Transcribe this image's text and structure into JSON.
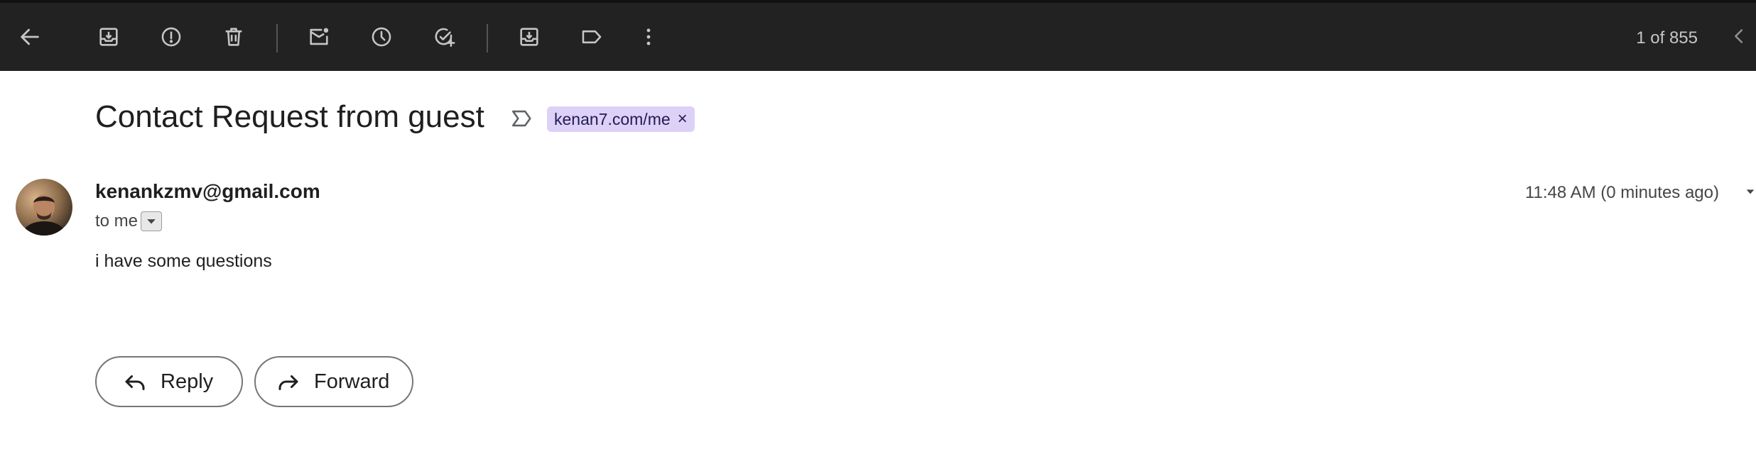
{
  "toolbar": {
    "buttons": [
      {
        "name": "back-button",
        "icon": "arrow-left-icon"
      },
      {
        "name": "archive-button",
        "icon": "archive-icon"
      },
      {
        "name": "report-spam-button",
        "icon": "report-spam-icon"
      },
      {
        "name": "delete-button",
        "icon": "trash-icon"
      },
      {
        "name": "mark-unread-button",
        "icon": "mark-unread-icon"
      },
      {
        "name": "snooze-button",
        "icon": "clock-icon"
      },
      {
        "name": "add-to-tasks-button",
        "icon": "add-task-icon"
      },
      {
        "name": "move-to-button",
        "icon": "move-to-icon"
      },
      {
        "name": "labels-button",
        "icon": "label-icon"
      },
      {
        "name": "more-button",
        "icon": "more-vert-icon"
      }
    ],
    "page_count": "1 of 855"
  },
  "email": {
    "subject": "Contact Request from guest",
    "label": "kenan7.com/me",
    "label_remove": "×",
    "label_color": "#ddd1f7",
    "sender": "kenankzmv@gmail.com",
    "recipients": "to me",
    "timestamp": "11:48 AM (0 minutes ago)",
    "body": "i have some questions"
  },
  "actions": {
    "reply_label": "Reply",
    "forward_label": "Forward"
  },
  "colors": {
    "toolbar_bg": "#222222",
    "icon": "#c4c7c5"
  }
}
